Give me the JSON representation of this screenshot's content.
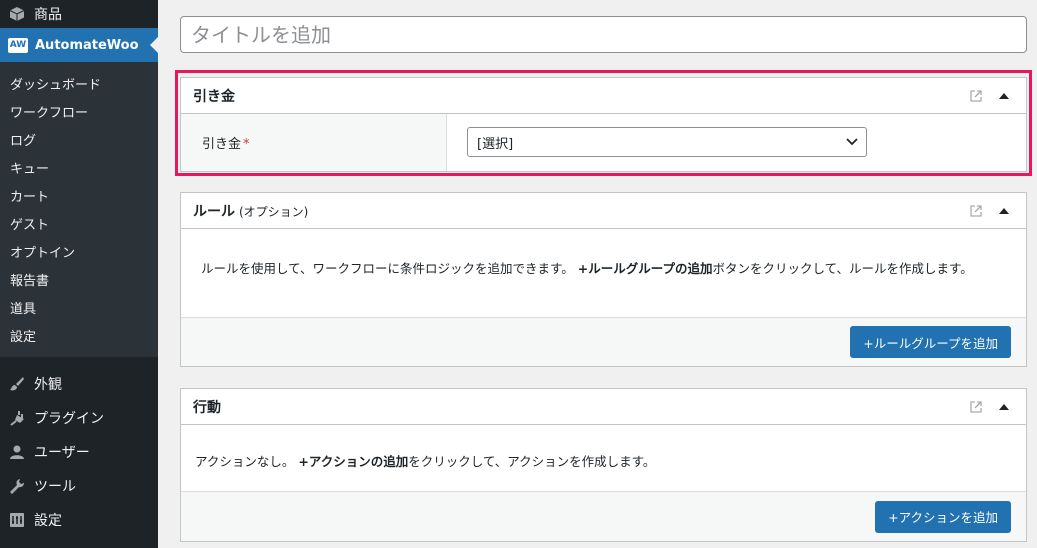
{
  "sidebar": {
    "products_label": "商品",
    "automatewoo_label": "AutomateWoo",
    "automatewoo_badge": "AW",
    "submenu": [
      "ダッシュボード",
      "ワークフロー",
      "ログ",
      "キュー",
      "カート",
      "ゲスト",
      "オプトイン",
      "報告書",
      "道具",
      "設定"
    ],
    "lower": [
      {
        "label": "外観",
        "icon": "brush-icon"
      },
      {
        "label": "プラグイン",
        "icon": "plugin-icon"
      },
      {
        "label": "ユーザー",
        "icon": "user-icon"
      },
      {
        "label": "ツール",
        "icon": "wrench-icon"
      },
      {
        "label": "設定",
        "icon": "settings-icon"
      }
    ]
  },
  "title_input": {
    "placeholder": "タイトルを追加",
    "value": ""
  },
  "trigger_box": {
    "title": "引き金",
    "field_label": "引き金",
    "required_mark": "*",
    "select_value": "[選択]"
  },
  "rules_box": {
    "title": "ルール",
    "title_sub": "(オプション)",
    "desc_pre": "ルールを使用して、ワークフローに条件ロジックを追加できます。 ",
    "desc_bold": "+ルールグループの追加",
    "desc_post": "ボタンをクリックして、ルールを作成します。",
    "button_label": "+ルールグループを追加"
  },
  "actions_box": {
    "title": "行動",
    "desc_pre": "アクションなし。 ",
    "desc_bold": "+アクションの追加",
    "desc_post": "をクリックして、アクションを作成します。",
    "button_label": "+アクションを追加"
  },
  "colors": {
    "accent": "#2271b1",
    "highlight": "#e8175d",
    "sidebar_bg": "#1d2327"
  }
}
